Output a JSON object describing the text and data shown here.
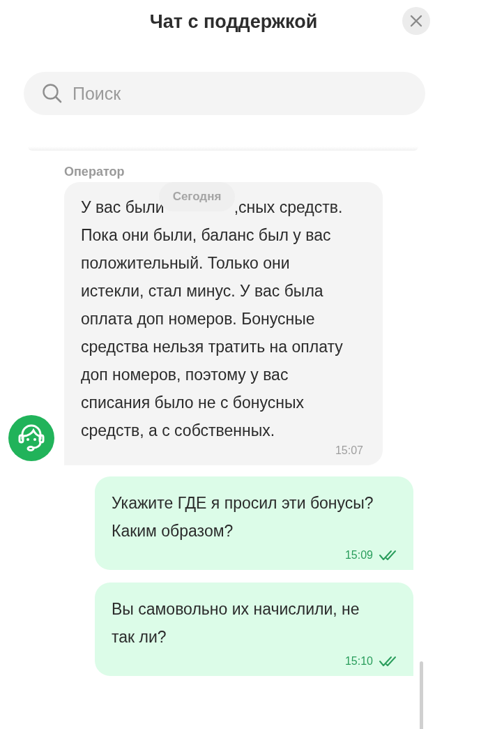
{
  "header": {
    "title": "Чат с поддержкой"
  },
  "search": {
    "placeholder": "Поиск"
  },
  "date_divider": "Сегодня",
  "messages": [
    {
      "kind": "operator",
      "author": "Оператор",
      "text_before_divider": "У вас были",
      "text": ",сных средств. Пока они были, баланс был у вас положительный. Только они истекли, стал минус. У вас была оплата доп номеров. Бонусные средства нельзя тратить на оплату доп номеров, поэтому у вас списания было не с бонусных средств, а с собственных.",
      "time": "15:07"
    },
    {
      "kind": "user",
      "text": "Укажите ГДЕ я просил эти бонусы? Каким образом?",
      "time": "15:09",
      "read": true
    },
    {
      "kind": "user",
      "text": "Вы самовольно их начислили, не так ли?",
      "time": "15:10",
      "read": true
    }
  ]
}
